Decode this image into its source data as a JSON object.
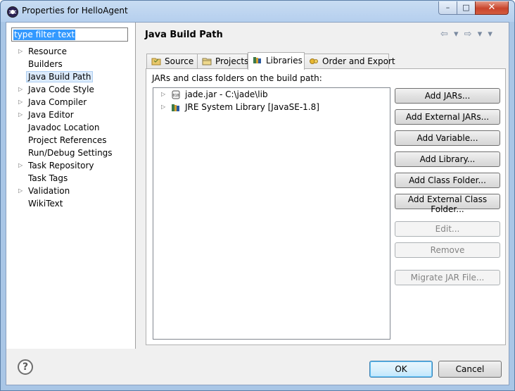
{
  "window": {
    "title": "Properties for HelloAgent",
    "minimize_glyph": "–",
    "maximize_glyph": "□",
    "close_glyph": "✕"
  },
  "filter": {
    "value": "type filter text"
  },
  "tree": {
    "items": [
      {
        "label": "Resource",
        "expandable": true
      },
      {
        "label": "Builders",
        "expandable": false
      },
      {
        "label": "Java Build Path",
        "expandable": false,
        "selected": true
      },
      {
        "label": "Java Code Style",
        "expandable": true
      },
      {
        "label": "Java Compiler",
        "expandable": true
      },
      {
        "label": "Java Editor",
        "expandable": true
      },
      {
        "label": "Javadoc Location",
        "expandable": false
      },
      {
        "label": "Project References",
        "expandable": false
      },
      {
        "label": "Run/Debug Settings",
        "expandable": false
      },
      {
        "label": "Task Repository",
        "expandable": true
      },
      {
        "label": "Task Tags",
        "expandable": false
      },
      {
        "label": "Validation",
        "expandable": true
      },
      {
        "label": "WikiText",
        "expandable": false
      }
    ]
  },
  "page": {
    "title": "Java Build Path",
    "nav": "⇦ ▾ ⇨ ▾ ▾"
  },
  "tabs": [
    {
      "label": "Source",
      "icon": "source-folder-icon"
    },
    {
      "label": "Projects",
      "icon": "projects-folder-icon"
    },
    {
      "label": "Libraries",
      "icon": "libraries-icon",
      "active": true
    },
    {
      "label": "Order and Export",
      "icon": "order-export-icon"
    }
  ],
  "libraries": {
    "label": "JARs and class folders on the build path:",
    "entries": [
      {
        "label": "jade.jar - C:\\jade\\lib",
        "icon": "jar-icon"
      },
      {
        "label": "JRE System Library [JavaSE-1.8]",
        "icon": "library-icon"
      }
    ]
  },
  "buttons": {
    "add_jars": "Add JARs...",
    "add_external_jars": "Add External JARs...",
    "add_variable": "Add Variable...",
    "add_library": "Add Library...",
    "add_class_folder": "Add Class Folder...",
    "add_external_class_folder": "Add External Class Folder...",
    "edit": "Edit...",
    "remove": "Remove",
    "migrate_jar": "Migrate JAR File..."
  },
  "footer": {
    "help": "?",
    "ok": "OK",
    "cancel": "Cancel"
  },
  "colors": {
    "selection": "#3399ff",
    "tree_selected": "#dcebfc",
    "close_button": "#c9452c"
  }
}
